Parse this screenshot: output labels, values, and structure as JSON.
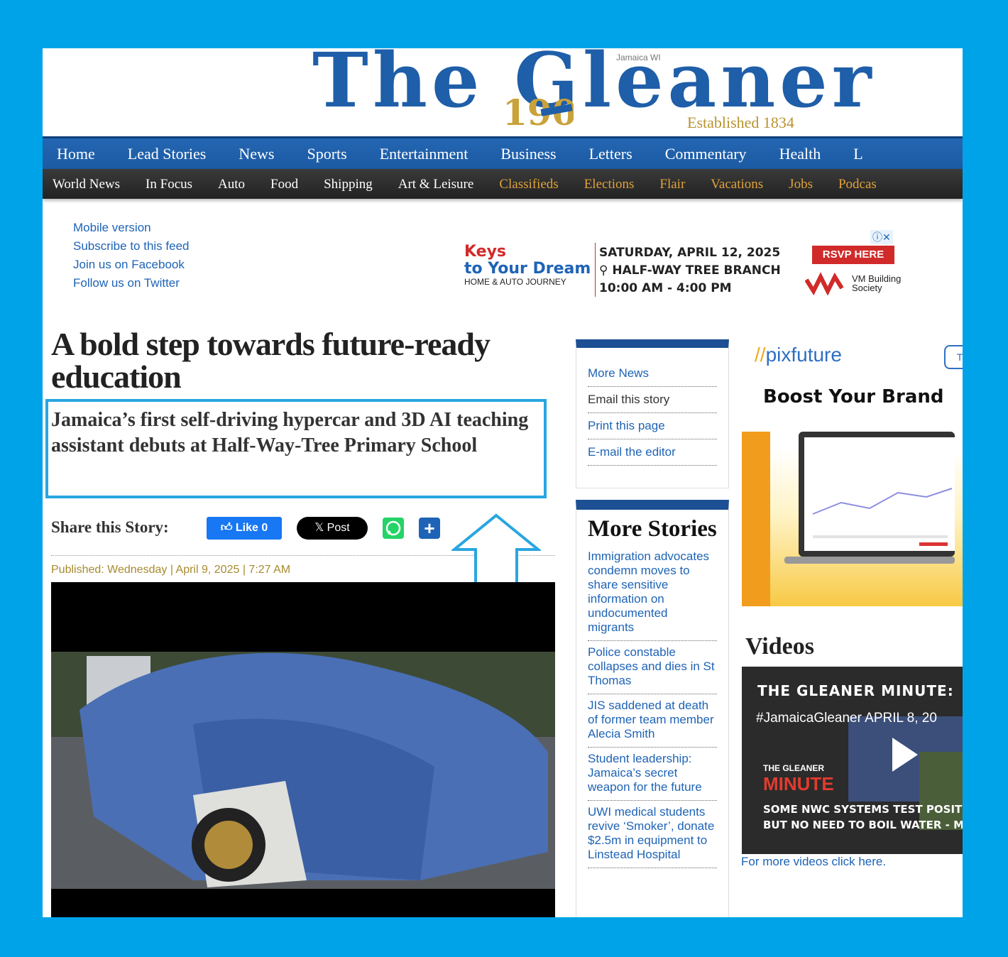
{
  "masthead": {
    "logo_text": "The Gleaner",
    "location": "Jamaica WI",
    "established": "Established 1834"
  },
  "nav_primary": [
    "Home",
    "Lead Stories",
    "News",
    "Sports",
    "Entertainment",
    "Business",
    "Letters",
    "Commentary",
    "Health",
    "L"
  ],
  "nav_secondary": [
    {
      "label": "World News",
      "highlight": false
    },
    {
      "label": "In Focus",
      "highlight": false
    },
    {
      "label": "Auto",
      "highlight": false
    },
    {
      "label": "Food",
      "highlight": false
    },
    {
      "label": "Shipping",
      "highlight": false
    },
    {
      "label": "Art & Leisure",
      "highlight": false
    },
    {
      "label": "Classifieds",
      "highlight": true
    },
    {
      "label": "Elections",
      "highlight": true
    },
    {
      "label": "Flair",
      "highlight": true
    },
    {
      "label": "Vacations",
      "highlight": true
    },
    {
      "label": "Jobs",
      "highlight": true
    },
    {
      "label": "Podcas",
      "highlight": true
    }
  ],
  "utility_links": [
    "Mobile version",
    "Subscribe to this feed",
    "Join us on Facebook",
    "Follow us on Twitter"
  ],
  "top_ad": {
    "brand_line1": "Keys",
    "brand_line2": "to Your Dream",
    "brand_sub": "HOME & AUTO JOURNEY",
    "date": "SATURDAY, APRIL 12, 2025",
    "location": "⚲ HALF-WAY TREE BRANCH",
    "time": "10:00 AM - 4:00 PM",
    "cta": "RSVP HERE",
    "sponsor": "VM Building Society"
  },
  "article": {
    "headline": "A bold step towards future-ready education",
    "subheadline": "Jamaica’s first self-driving hypercar and 3D AI teaching assistant debuts at Half-Way-Tree Primary School",
    "share_label": "Share this Story:",
    "like_label": "Like 0",
    "post_label": "𝕏 Post",
    "published": "Published: Wednesday | April 9, 2025 | 7:27 AM"
  },
  "toolbox": {
    "items": [
      {
        "label": "More News",
        "link": true
      },
      {
        "label": "Email this story",
        "link": false
      },
      {
        "label": "Print this page",
        "link": true
      },
      {
        "label": "E-mail the editor",
        "link": true
      }
    ]
  },
  "more_stories": {
    "title": "More Stories",
    "items": [
      "Immigration advocates condemn moves to share sensitive information on undocumented migrants",
      "Police constable collapses and dies in St Thomas",
      "JIS saddened at death of former team member Alecia Smith",
      "Student leadership: Jamaica’s secret weapon for the future",
      "UWI medical students revive ‘Smoker’, donate $2.5m in equipment to Linstead Hospital"
    ]
  },
  "side_ad": {
    "logo_slash": "//",
    "logo": "pixfuture",
    "headline": "Boost Your Brand",
    "tab": "T"
  },
  "videos": {
    "title": "Videos",
    "video_title": "THE GLEANER MINUTE:",
    "video_tag": "#JamaicaGleaner APRIL 8, 20",
    "brand_small": "THE GLEANER",
    "brand_big": "MINUTE",
    "caption_line1": "SOME NWC SYSTEMS TEST POSITIVE",
    "caption_line2": "BUT NO NEED TO BOIL WATER - MOH",
    "more_link": "For more videos click here."
  },
  "colors": {
    "background": "#00a3e8",
    "nav_blue": "#1c5aa3",
    "link_blue": "#1e63b6",
    "highlight_gold": "#e0a23a",
    "annotation_box": "#29a6e0"
  }
}
